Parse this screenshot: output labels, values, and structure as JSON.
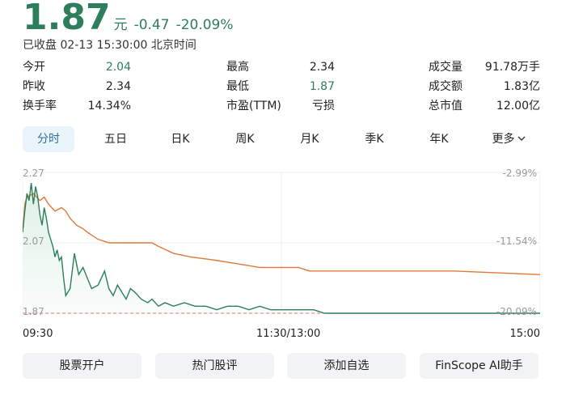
{
  "quote": {
    "price": "1.87",
    "unit": "元",
    "change": "-0.47",
    "change_pct": "-20.09%",
    "status": "已收盘 02-13 15:30:00 北京时间",
    "accent_color": "#2e7d5b"
  },
  "stats": [
    {
      "label": "今开",
      "value": "2.04",
      "color": "green"
    },
    {
      "label": "最高",
      "value": "2.34",
      "color": "default"
    },
    {
      "label": "成交量",
      "value": "91.78万手",
      "color": "default"
    },
    {
      "label": "昨收",
      "value": "2.34",
      "color": "default"
    },
    {
      "label": "最低",
      "value": "1.87",
      "color": "green"
    },
    {
      "label": "成交额",
      "value": "1.83亿",
      "color": "default"
    },
    {
      "label": "换手率",
      "value": "14.34%",
      "color": "default"
    },
    {
      "label": "市盈(TTM)",
      "value": "亏损",
      "color": "default"
    },
    {
      "label": "总市值",
      "value": "12.00亿",
      "color": "default"
    }
  ],
  "tabs": [
    {
      "label": "分时",
      "active": true
    },
    {
      "label": "五日",
      "active": false
    },
    {
      "label": "日K",
      "active": false
    },
    {
      "label": "周K",
      "active": false
    },
    {
      "label": "月K",
      "active": false
    },
    {
      "label": "季K",
      "active": false
    },
    {
      "label": "年K",
      "active": false
    },
    {
      "label": "更多",
      "active": false,
      "icon": "chevron-down-icon"
    }
  ],
  "chart_data": {
    "type": "line",
    "y_left_ticks": [
      "2.27",
      "2.07",
      "1.87"
    ],
    "y_right_ticks": [
      "-2.99%",
      "-11.54%",
      "-20.09%"
    ],
    "ylim": [
      1.87,
      2.27
    ],
    "x_ticks": [
      "09:30",
      "11:30/13:00",
      "15:00"
    ],
    "grid": true,
    "limit_line": 1.87,
    "series": [
      {
        "color": "#2e7d5b",
        "fill": true,
        "x": [
          0,
          1,
          2,
          3,
          4,
          5,
          6,
          7,
          8,
          9,
          10,
          11,
          12,
          13,
          14,
          15,
          16,
          17,
          18,
          19,
          20,
          22,
          24,
          26,
          28,
          30,
          32,
          35,
          38,
          40,
          42,
          44,
          46,
          48,
          50,
          52,
          55,
          58,
          60,
          63,
          66,
          70,
          75,
          80,
          85,
          90,
          95,
          100,
          105,
          110,
          115,
          120,
          125,
          130,
          135,
          140,
          150,
          160,
          170,
          180,
          190,
          200,
          210,
          220,
          230,
          240
        ],
        "values": [
          2.1,
          2.16,
          2.21,
          2.19,
          2.24,
          2.18,
          2.23,
          2.2,
          2.15,
          2.12,
          2.17,
          2.14,
          2.1,
          2.08,
          2.06,
          2.03,
          2.05,
          2.02,
          2.03,
          1.97,
          1.92,
          1.94,
          2.04,
          1.98,
          2.0,
          1.97,
          1.94,
          1.95,
          1.99,
          1.94,
          1.92,
          1.95,
          1.93,
          1.91,
          1.94,
          1.93,
          1.91,
          1.9,
          1.91,
          1.89,
          1.9,
          1.89,
          1.9,
          1.89,
          1.89,
          1.88,
          1.89,
          1.89,
          1.88,
          1.89,
          1.88,
          1.88,
          1.88,
          1.88,
          1.88,
          1.87,
          1.87,
          1.87,
          1.87,
          1.87,
          1.87,
          1.87,
          1.87,
          1.87,
          1.87,
          1.87
        ]
      },
      {
        "color": "#e0793a",
        "fill": false,
        "x": [
          0,
          1,
          2,
          5,
          8,
          10,
          12,
          15,
          18,
          20,
          22,
          25,
          28,
          30,
          35,
          40,
          60,
          63,
          70,
          78,
          90,
          100,
          110,
          128,
          133,
          160,
          200,
          239,
          240
        ],
        "values": [
          2.1,
          2.18,
          2.2,
          2.21,
          2.19,
          2.2,
          2.18,
          2.16,
          2.17,
          2.16,
          2.14,
          2.12,
          2.11,
          2.1,
          2.08,
          2.07,
          2.07,
          2.06,
          2.04,
          2.03,
          2.02,
          2.01,
          2.0,
          2.0,
          1.99,
          1.99,
          1.99,
          1.98,
          1.98
        ]
      }
    ]
  },
  "buttons": [
    {
      "label": "股票开户"
    },
    {
      "label": "热门股评"
    },
    {
      "label": "添加自选"
    },
    {
      "label": "FinScope AI助手"
    }
  ]
}
